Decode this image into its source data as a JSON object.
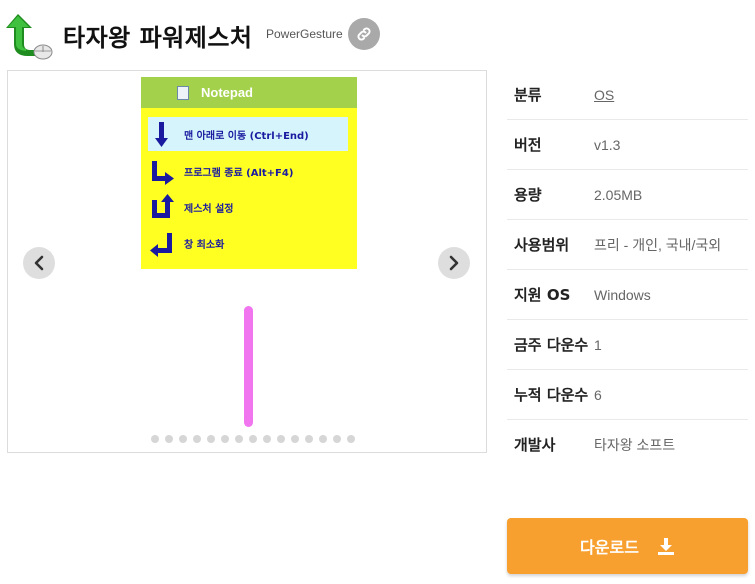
{
  "header": {
    "title": "타자왕 파워제스처",
    "english_name": "PowerGesture",
    "app_icon": "green-up-arrow-with-mouse-icon",
    "link_icon": "link-icon"
  },
  "gallery": {
    "screenshot": {
      "window_title": "Notepad",
      "gestures": [
        {
          "label": "맨 아래로 이동 (Ctrl+End)",
          "icon": "arrow-down-icon"
        },
        {
          "label": "프로그램 종료 (Alt+F4)",
          "icon": "arrow-down-right-icon"
        },
        {
          "label": "제스처 설정",
          "icon": "arrow-up-right-icon"
        },
        {
          "label": "창 최소화",
          "icon": "arrow-left-down-icon"
        }
      ]
    },
    "prev_icon": "chevron-left-icon",
    "next_icon": "chevron-right-icon",
    "dot_count": 15
  },
  "info": [
    {
      "label": "분류",
      "value": "OS",
      "is_link": true
    },
    {
      "label": "버전",
      "value": "v1.3"
    },
    {
      "label": "용량",
      "value": "2.05MB"
    },
    {
      "label": "사용범위",
      "value": "프리 - 개인, 국내/국외"
    },
    {
      "label": "지원 OS",
      "value": "Windows"
    },
    {
      "label": "금주 다운수",
      "value": "1"
    },
    {
      "label": "누적 다운수",
      "value": "6"
    },
    {
      "label": "개발사",
      "value": "타자왕 소프트"
    }
  ],
  "download": {
    "label": "다운로드",
    "icon": "download-icon"
  },
  "colors": {
    "accent": "#f7a030",
    "screenshot_bar": "#a3d14b",
    "screenshot_bg": "#ffff22",
    "gesture_text": "#1a1aa0",
    "pink_stroke": "#f075ee"
  }
}
